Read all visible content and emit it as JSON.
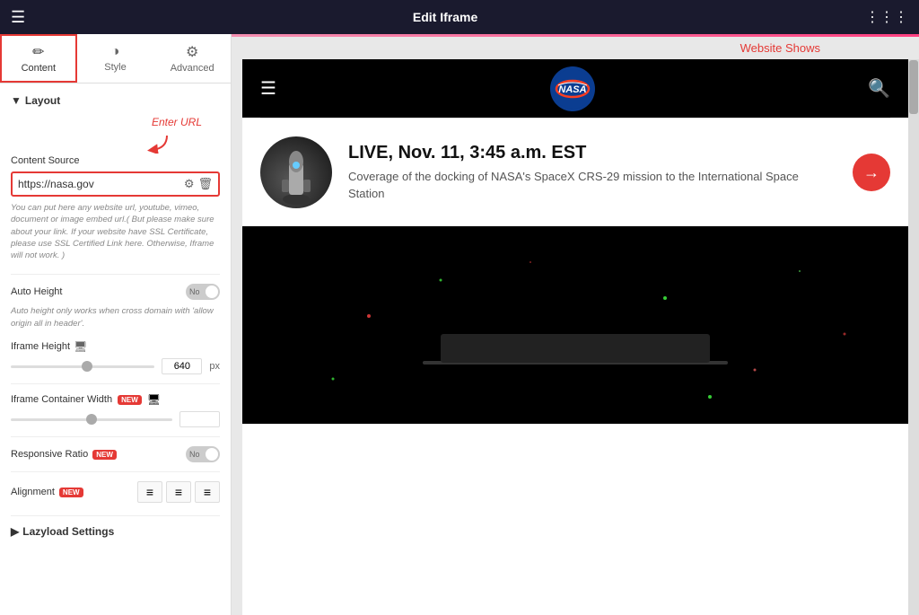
{
  "topbar": {
    "title": "Edit Iframe",
    "hamburger": "☰",
    "grid": "⋮⋮⋮"
  },
  "tabs": [
    {
      "id": "content",
      "label": "Content",
      "icon": "✏️",
      "active": true
    },
    {
      "id": "style",
      "label": "Style",
      "icon": "◑",
      "active": false
    },
    {
      "id": "advanced",
      "label": "Advanced",
      "icon": "⚙",
      "active": false
    }
  ],
  "sidebar": {
    "layout_label": "Layout",
    "enter_url_label": "Enter URL",
    "content_source_label": "Content Source",
    "url_value": "https://nasa.gov",
    "hint_text": "You can put here any website url, youtube, vimeo, document or image embed url.( But please make sure about your link. If your website have SSL Certificate, please use SSL Certified Link here. Otherwise, Iframe will not work. )",
    "auto_height_label": "Auto Height",
    "auto_height_toggle": "No",
    "auto_height_hint": "Auto height only works when cross domain with 'allow origin all in header'.",
    "iframe_height_label": "Iframe Height",
    "iframe_height_value": "640",
    "iframe_height_unit": "px",
    "iframe_container_width_label": "Iframe Container Width",
    "responsive_ratio_label": "Responsive Ratio",
    "responsive_ratio_toggle": "No",
    "alignment_label": "Alignment",
    "lazy_load_label": "Lazyload Settings"
  },
  "annotation": {
    "website_shows": "Website Shows"
  },
  "nasa": {
    "article_title": "LIVE, Nov. 11, 3:45 a.m. EST",
    "article_desc": "Coverage of the docking of NASA's SpaceX CRS-29 mission to the International Space Station"
  }
}
